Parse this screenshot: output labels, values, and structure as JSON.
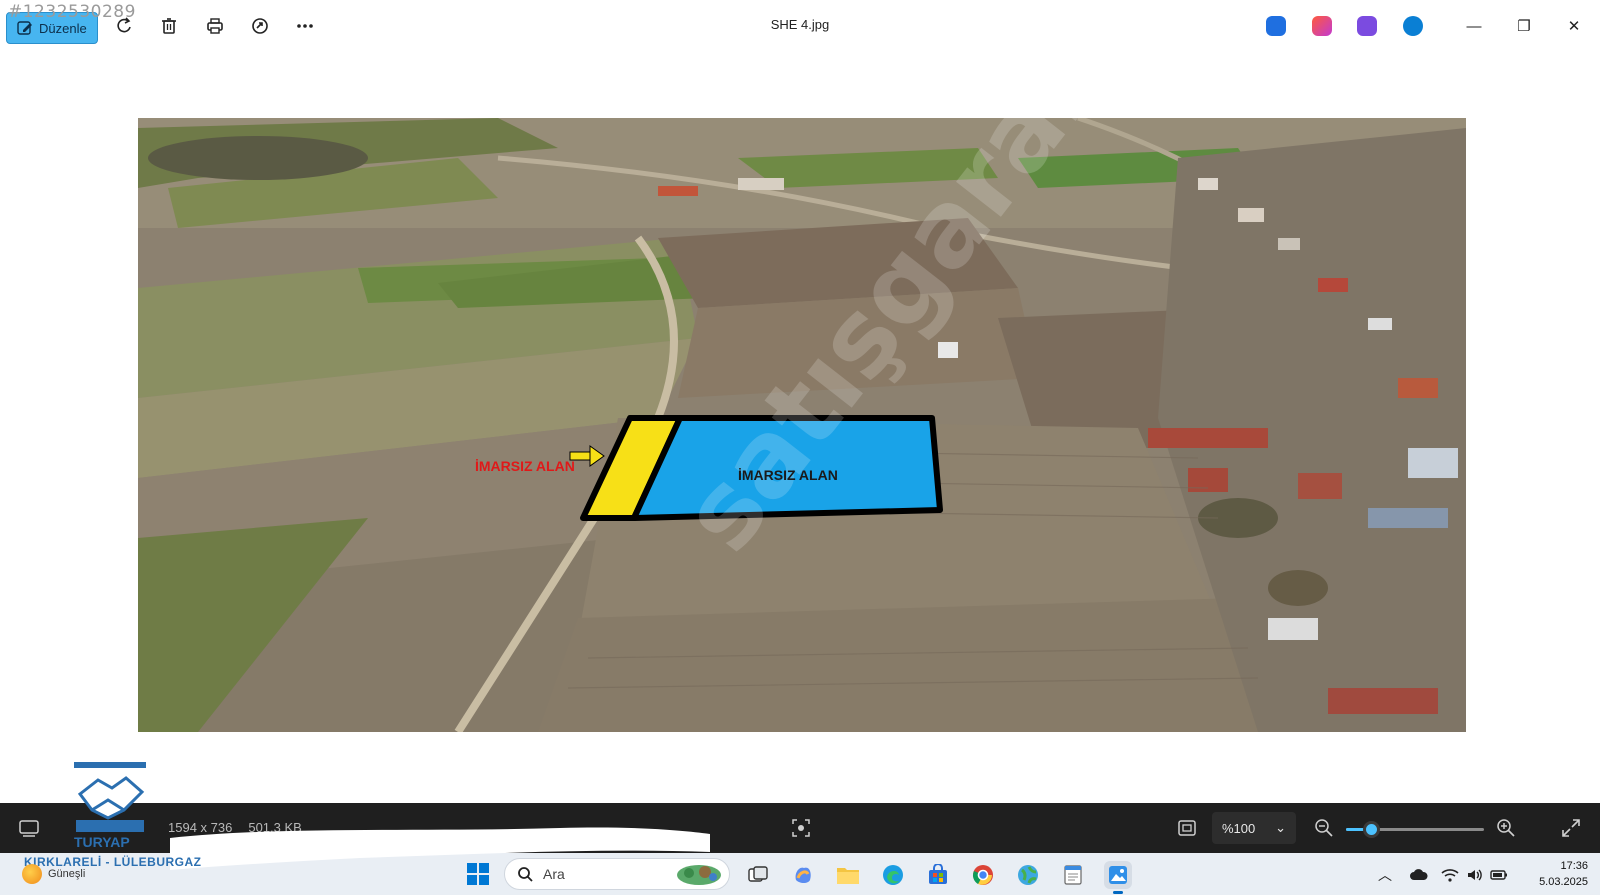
{
  "titlebar": {
    "watermark_id": "#1232530289",
    "edit_label": "Düzenle",
    "file_title": "SHE 4.jpg",
    "icons": [
      "edit-icon",
      "rotate-icon",
      "delete-icon",
      "print-icon",
      "share-icon",
      "more-icon",
      "minimize-icon",
      "restore-icon",
      "close-icon"
    ],
    "app_icon_colors": [
      "#1f6fe0",
      "#c23ad1",
      "#7b4be0",
      "#0a7fd4"
    ]
  },
  "photo": {
    "annotation_left": "İMARSIZ ALAN",
    "annotation_center": "İMARSIZ ALAN",
    "watermark": "satışgaranti.com",
    "blue_area_color": "#19a3e8",
    "yellow_area_color": "#f7e017"
  },
  "logo": {
    "name": "TURYAP",
    "subtitle": "KIRKLARELİ - LÜLEBURGAZ"
  },
  "statusbar": {
    "dimensions": "1594 x 736",
    "filesize": "501.3 KB",
    "zoom_label": "%100",
    "zoom_level": 0.18
  },
  "taskbar": {
    "weather_text": "Güneşli",
    "search_placeholder": "Ara",
    "apps": [
      "task-view",
      "copilot",
      "file-explorer",
      "edge",
      "store",
      "chrome",
      "globe-app",
      "notepad-app",
      "photos-app"
    ],
    "time": "17:36",
    "date": "5.03.2025"
  }
}
